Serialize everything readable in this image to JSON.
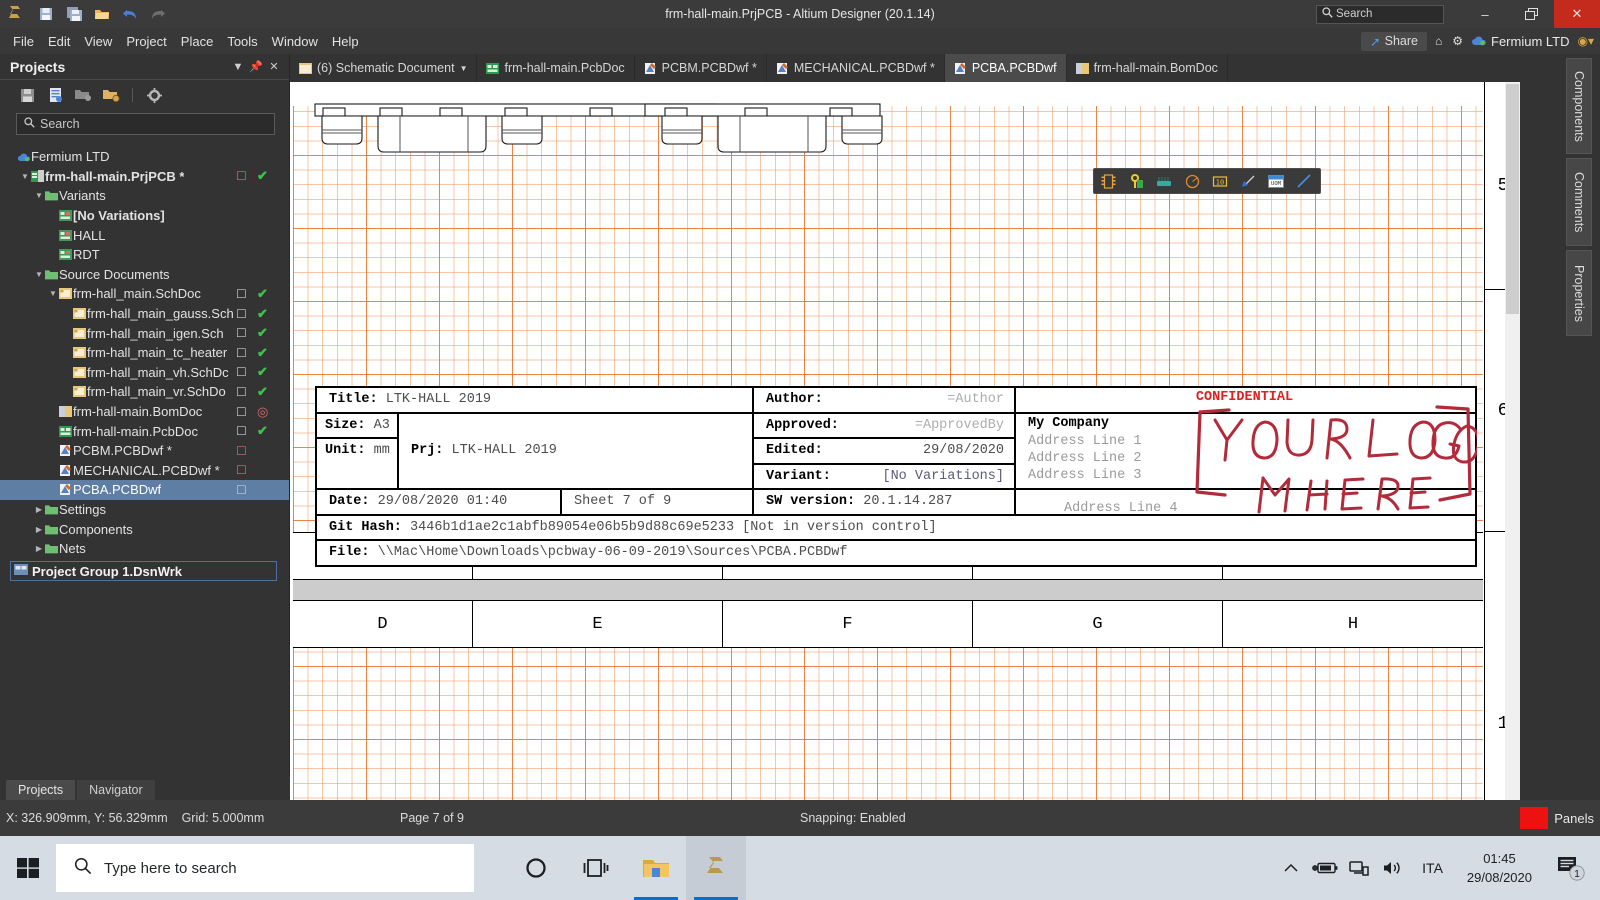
{
  "titlebar": {
    "app_title": "frm-hall-main.PrjPCB - Altium Designer (20.1.14)",
    "search_placeholder": "Search",
    "logo_icon": "altium-logo-icon",
    "quick_icons": [
      "save-icon",
      "save-all-icon",
      "open-icon",
      "undo-icon",
      "redo-icon"
    ],
    "minimize_label": "–",
    "restore_label": "❐",
    "close_label": "✕"
  },
  "menubar": {
    "items": [
      "File",
      "Edit",
      "View",
      "Project",
      "Place",
      "Tools",
      "Window",
      "Help"
    ],
    "share_label": "Share",
    "org_label": "Fermium LTD",
    "home_icon": "home-icon",
    "gear_icon": "gear-icon",
    "cloud_icon": "cloud-icon",
    "account_icon": "account-icon"
  },
  "doctabs": [
    {
      "label": "(6) Schematic Document",
      "icon": "schematic-doc-icon",
      "active": false,
      "dropdown": true
    },
    {
      "label": "frm-hall-main.PcbDoc",
      "icon": "pcb-doc-icon",
      "active": false,
      "dropdown": false
    },
    {
      "label": "PCBM.PCBDwf *",
      "icon": "draftsman-icon",
      "active": false,
      "dropdown": false
    },
    {
      "label": "MECHANICAL.PCBDwf *",
      "icon": "draftsman-icon",
      "active": false,
      "dropdown": false
    },
    {
      "label": "PCBA.PCBDwf",
      "icon": "draftsman-icon",
      "active": true,
      "dropdown": false
    },
    {
      "label": "frm-hall-main.BomDoc",
      "icon": "bom-doc-icon",
      "active": false,
      "dropdown": false
    }
  ],
  "panel": {
    "title": "Projects",
    "header_buttons": [
      "chevron-down-icon",
      "pin-icon",
      "close-icon"
    ],
    "toolbar_icons": [
      "save-icon",
      "compile-icon",
      "open-project-icon",
      "add-folder-icon",
      "gear-icon"
    ],
    "search_placeholder": "Search",
    "tabs": [
      {
        "label": "Projects",
        "active": true
      },
      {
        "label": "Navigator",
        "active": false
      }
    ],
    "project_group": "Project Group 1.DsnWrk",
    "tree": [
      {
        "label": "Fermium LTD",
        "indent": 0,
        "icon": "cloud-icon",
        "twisty": "",
        "bold": false,
        "doc": "",
        "status": ""
      },
      {
        "label": "frm-hall-main.PrjPCB *",
        "indent": 1,
        "icon": "project-icon",
        "twisty": "down",
        "bold": true,
        "doc": "red",
        "status": "check"
      },
      {
        "label": "Variants",
        "indent": 2,
        "icon": "folder-icon",
        "twisty": "down",
        "bold": false,
        "doc": "",
        "status": ""
      },
      {
        "label": "[No Variations]",
        "indent": 3,
        "icon": "variant-icon",
        "twisty": "",
        "bold": true,
        "doc": "",
        "status": ""
      },
      {
        "label": "HALL",
        "indent": 3,
        "icon": "variant-icon",
        "twisty": "",
        "bold": false,
        "doc": "",
        "status": ""
      },
      {
        "label": "RDT",
        "indent": 3,
        "icon": "variant-icon",
        "twisty": "",
        "bold": false,
        "doc": "",
        "status": ""
      },
      {
        "label": "Source Documents",
        "indent": 2,
        "icon": "folder-icon",
        "twisty": "down",
        "bold": false,
        "doc": "",
        "status": ""
      },
      {
        "label": "frm-hall_main.SchDoc",
        "indent": 3,
        "icon": "sch-icon",
        "twisty": "down",
        "bold": false,
        "doc": "gray",
        "status": "check"
      },
      {
        "label": "frm-hall_main_gauss.Sch",
        "indent": 4,
        "icon": "sch-icon",
        "twisty": "",
        "bold": false,
        "doc": "gray",
        "status": "check"
      },
      {
        "label": "frm-hall_main_igen.Sch",
        "indent": 4,
        "icon": "sch-icon",
        "twisty": "",
        "bold": false,
        "doc": "gray",
        "status": "check"
      },
      {
        "label": "frm-hall_main_tc_heater",
        "indent": 4,
        "icon": "sch-icon",
        "twisty": "",
        "bold": false,
        "doc": "gray",
        "status": "check"
      },
      {
        "label": "frm-hall_main_vh.SchDc",
        "indent": 4,
        "icon": "sch-icon",
        "twisty": "",
        "bold": false,
        "doc": "gray",
        "status": "check"
      },
      {
        "label": "frm-hall_main_vr.SchDo",
        "indent": 4,
        "icon": "sch-icon",
        "twisty": "",
        "bold": false,
        "doc": "gray",
        "status": "check"
      },
      {
        "label": "frm-hall-main.BomDoc",
        "indent": 3,
        "icon": "bom-doc-icon",
        "twisty": "",
        "bold": false,
        "doc": "gray",
        "status": "ring"
      },
      {
        "label": "frm-hall-main.PcbDoc",
        "indent": 3,
        "icon": "pcb-doc-icon",
        "twisty": "",
        "bold": false,
        "doc": "gray",
        "status": "check"
      },
      {
        "label": "PCBM.PCBDwf *",
        "indent": 3,
        "icon": "draftsman-icon",
        "twisty": "",
        "bold": false,
        "doc": "red",
        "status": ""
      },
      {
        "label": "MECHANICAL.PCBDwf *",
        "indent": 3,
        "icon": "draftsman-icon",
        "twisty": "",
        "bold": false,
        "doc": "red",
        "status": ""
      },
      {
        "label": "PCBA.PCBDwf",
        "indent": 3,
        "icon": "draftsman-icon",
        "twisty": "",
        "bold": false,
        "doc": "gray",
        "status": "",
        "selected": true
      },
      {
        "label": "Settings",
        "indent": 2,
        "icon": "folder-icon",
        "twisty": "right",
        "bold": false,
        "doc": "",
        "status": ""
      },
      {
        "label": "Components",
        "indent": 2,
        "icon": "folder-icon",
        "twisty": "right",
        "bold": false,
        "doc": "",
        "status": ""
      },
      {
        "label": "Nets",
        "indent": 2,
        "icon": "folder-icon",
        "twisty": "right",
        "bold": false,
        "doc": "",
        "status": ""
      }
    ]
  },
  "floating_toolbar": {
    "icons": [
      "component-icon",
      "key-dimension-icon",
      "board-assembly-icon",
      "circle-icon",
      "dimension-icon",
      "leader-arrow-icon",
      "note-icon",
      "line-icon"
    ]
  },
  "titleblock": {
    "title_key": "Title:",
    "title_value": "LTK-HALL 2019",
    "size_key": "Size:",
    "size_value": "A3",
    "unit_key": "Unit:",
    "unit_value": "mm",
    "prj_key": "Prj:",
    "prj_value": "LTK-HALL 2019",
    "date_key": "Date:",
    "date_value": "29/08/2020 01:40",
    "sheet_value": "Sheet  7  of 9",
    "git_key": "Git Hash:",
    "git_value": "3446b1d1ae2c1abfb89054e06b5b9d88c69e5233 [Not in version control]",
    "file_key": "File:",
    "file_value": "\\\\Mac\\Home\\Downloads\\pcbway-06-09-2019\\Sources\\PCBA.PCBDwf",
    "author_key": "Author:",
    "author_value": "=Author",
    "approved_key": "Approved:",
    "approved_value": "=ApprovedBy",
    "edited_key": "Edited:",
    "edited_value": "29/08/2020",
    "variant_key": "Variant:",
    "variant_value": "[No Variations]",
    "sw_key": "SW version:",
    "sw_value": "20.1.14.287",
    "confidential": "CONFIDENTIAL",
    "company": "My Company",
    "address": [
      "Address Line 1",
      "Address Line 2",
      "Address Line 3",
      "Address Line 4"
    ],
    "confidential_color": "#e02020",
    "logo_placeholder_line1": "YOUR LOGO",
    "logo_placeholder_line2": "HERE",
    "logo_placeholder_color": "#b32a3a"
  },
  "canvas": {
    "row_letters": [
      "D",
      "E",
      "F",
      "G",
      "H"
    ],
    "right_row_numbers": [
      "5",
      "6",
      "1"
    ]
  },
  "right_panel_tabs": [
    "Components",
    "Comments",
    "Properties"
  ],
  "statusbar": {
    "coords": "X: 326.909mm, Y: 56.329mm",
    "grid": "Grid: 5.000mm",
    "page": "Page 7 of 9",
    "snapping": "Snapping: Enabled",
    "panels_label": "Panels"
  },
  "taskbar": {
    "start_icon": "windows-start-icon",
    "search_placeholder": "Type here to search",
    "apps": [
      {
        "icon": "cortana-icon",
        "name": "cortana",
        "active": false
      },
      {
        "icon": "task-view-icon",
        "name": "task-view",
        "active": false
      },
      {
        "icon": "file-explorer-icon",
        "name": "file-explorer",
        "active": true
      },
      {
        "icon": "altium-icon",
        "name": "altium-designer",
        "active": true
      }
    ],
    "tray_icons": [
      "chevron-up-icon",
      "battery-icon",
      "network-icon",
      "volume-icon"
    ],
    "language": "ITA",
    "clock_time": "01:45",
    "clock_date": "29/08/2020",
    "notification_icon": "action-center-icon",
    "notification_count": "1"
  }
}
